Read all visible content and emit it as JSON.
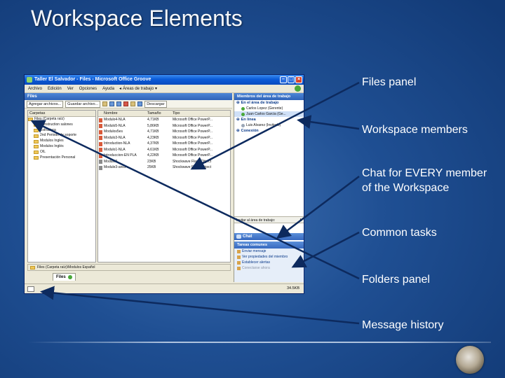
{
  "slide": {
    "title": "Workspace Elements",
    "callouts": [
      "Files panel",
      "Workspace members",
      "Chat for EVERY member",
      "of the Workspace",
      "Common tasks",
      "Folders panel",
      "Message history"
    ]
  },
  "window": {
    "title": "Taller El Salvador - Files - Microsoft Office Groove",
    "menus": [
      "Archivo",
      "Edición",
      "Ver",
      "Opciones",
      "Ayuda"
    ],
    "workspace_area": "Áreas de trabajo",
    "tool_panel_title": "Files",
    "toolbar": {
      "add_files": "Agregar archivos...",
      "save_file": "Guardar archivo...",
      "download": "Descargar"
    },
    "folders": {
      "header": "Carpetas",
      "items": [
        "Files (Carpeta raíz)",
        "Construction salones",
        "Estructura",
        "2nd Periodo de soporte",
        "Modulos Ingles",
        "Modulos Inglés",
        "OIL",
        "Presentación Personal"
      ]
    },
    "files": {
      "columns": [
        "Nombre",
        "Tamaño",
        "Tipo"
      ],
      "rows": [
        [
          "Modulo4-NLA",
          "4,71KB",
          "Microsoft Office PowerP..."
        ],
        [
          "Modulo5-NLA",
          "5,86KB",
          "Microsoft Office PowerP..."
        ],
        [
          "Modulos5es",
          "4,71KB",
          "Microsoft Office PowerP..."
        ],
        [
          "Modulo3-NLA",
          "4,23KB",
          "Microsoft Office PowerP..."
        ],
        [
          "Introduction-NLA",
          "4,37KB",
          "Microsoft Office PowerP..."
        ],
        [
          "Modulo1-NLA",
          "4,61KB",
          "Microsoft Office PowerP..."
        ],
        [
          "Introduccion-EN PLA",
          "4,22KB",
          "Microsoft Office PowerP..."
        ],
        [
          "Module2",
          "23KB",
          "Shockwave Flash Object"
        ],
        [
          "Module3-area-...",
          "25KB",
          "Shockwave Flash Object"
        ]
      ]
    },
    "path": "Files (Carpeta raíz)\\Modulos Español",
    "tab": "Files",
    "members_panel": {
      "title": "Miembros del área de trabajo",
      "groups": [
        {
          "label": "En el área de trabajo",
          "members": [
            "Carlos Lopez (Gerente)",
            "Juan Carlos Garcia (Ge..."
          ]
        },
        {
          "label": "En línea",
          "members": [
            "Luis Alvarez (Invitado)"
          ]
        },
        {
          "label": "Conexión",
          "members": []
        }
      ],
      "chat_input": "Invitar al área de trabajo:",
      "send": "Ir"
    },
    "chat_label": "Chat",
    "tasks": {
      "title": "Tareas comunes",
      "items": [
        "Enviar mensaje",
        "Ver propiedades del miembro",
        "Establecer alertas",
        "Conectarse ahora"
      ]
    },
    "status_size": "34.5KB"
  }
}
